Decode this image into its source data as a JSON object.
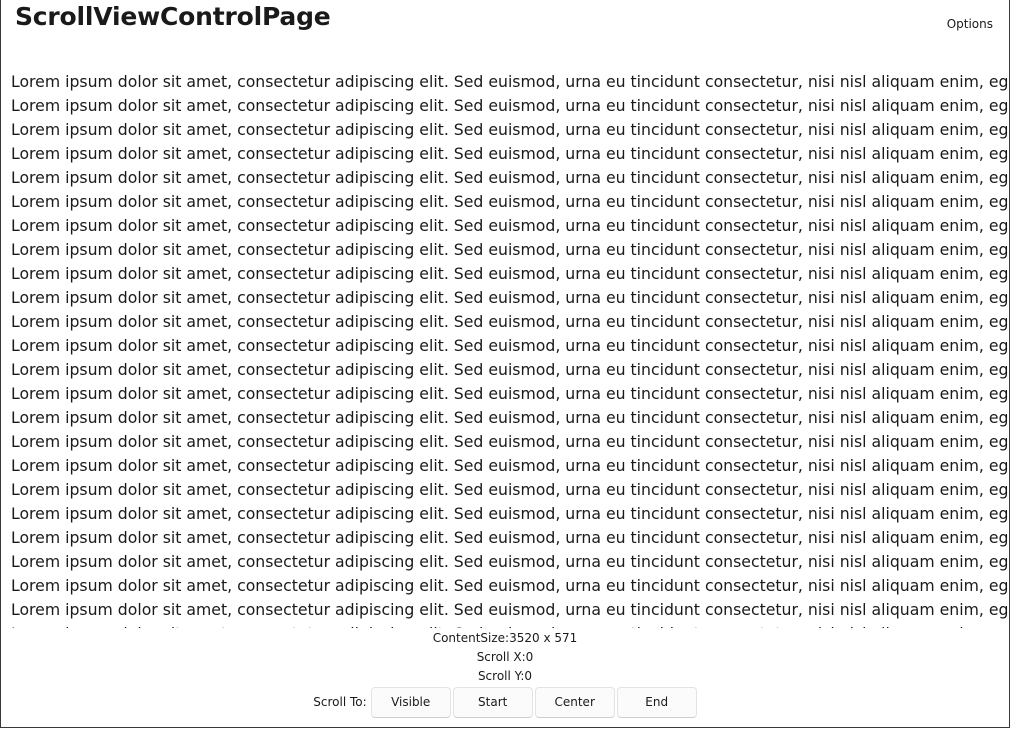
{
  "page": {
    "title": "ScrollViewControlPage",
    "options_label": "Options"
  },
  "scroll_view": {
    "line_text": "Lorem ipsum dolor sit amet, consectetur adipiscing elit. Sed euismod, urna eu tincidunt consectetur, nisi nisl aliquam enim, eget facilisis quam felis id mauris."
  },
  "info": {
    "content_size": "ContentSize:3520 x 571",
    "scroll_x": "Scroll X:0",
    "scroll_y": "Scroll Y:0"
  },
  "scroll_to": {
    "label": "Scroll To:",
    "buttons": [
      "Visible",
      "Start",
      "Center",
      "End"
    ]
  }
}
